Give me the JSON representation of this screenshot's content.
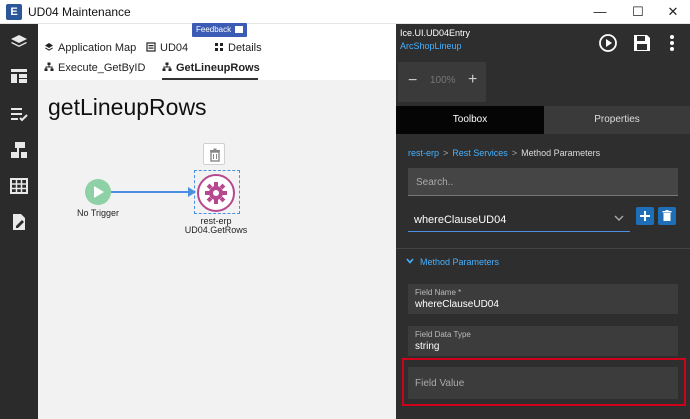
{
  "window": {
    "logo_letter": "E",
    "title": "UD04 Maintenance",
    "controls": {
      "minimize": "—",
      "maximize": "☐",
      "close": "✕"
    }
  },
  "leftrail": {
    "icons": [
      "layers-icon",
      "layout-icon",
      "checklist-icon",
      "flow-icon",
      "grid-icon",
      "edit-doc-icon"
    ]
  },
  "tabs": {
    "feedback_label": "Feedback",
    "row1": [
      {
        "label": "Application Map",
        "icon": "layers-icon"
      },
      {
        "label": "UD04",
        "icon": "form-icon"
      },
      {
        "label": "Details",
        "icon": "details-icon"
      }
    ],
    "row2": [
      {
        "label": "Execute_GetByID",
        "icon": "method-icon"
      },
      {
        "label": "GetLineupRows",
        "icon": "method-icon",
        "active": true
      }
    ]
  },
  "canvas": {
    "heading": "getLineupRows",
    "trigger_label": "No Trigger",
    "node_label_line1": "rest-erp",
    "node_label_line2": "UD04.GetRows"
  },
  "panel": {
    "title": "Ice.UI.UD04Entry",
    "subtitle": "ArcShopLineup",
    "zoom": {
      "minus": "−",
      "value": "100%",
      "plus": "+"
    },
    "tabs": [
      {
        "label": "Toolbox",
        "active": true
      },
      {
        "label": "Properties",
        "active": false
      }
    ],
    "breadcrumb": [
      {
        "label": "rest-erp",
        "link": true
      },
      {
        "label": "Rest Services",
        "link": true
      },
      {
        "label": "Method Parameters",
        "link": false
      }
    ],
    "breadcrumb_sep": ">",
    "search_placeholder": "Search..",
    "selected_param": "whereClauseUD04",
    "add_label": "+",
    "section_title": "Method Parameters",
    "fields": {
      "name_label": "Field Name *",
      "name_value": "whereClauseUD04",
      "type_label": "Field Data Type",
      "type_value": "string",
      "value_placeholder": "Field Value"
    }
  },
  "colors": {
    "accent": "#45b1ff",
    "panel_bg": "#2e2e2e",
    "rail_bg": "#2b2b2b",
    "trigger": "#8ed1a6",
    "node_ring": "#b7488f",
    "highlight": "#d0021b",
    "button": "#1e6fb8"
  }
}
